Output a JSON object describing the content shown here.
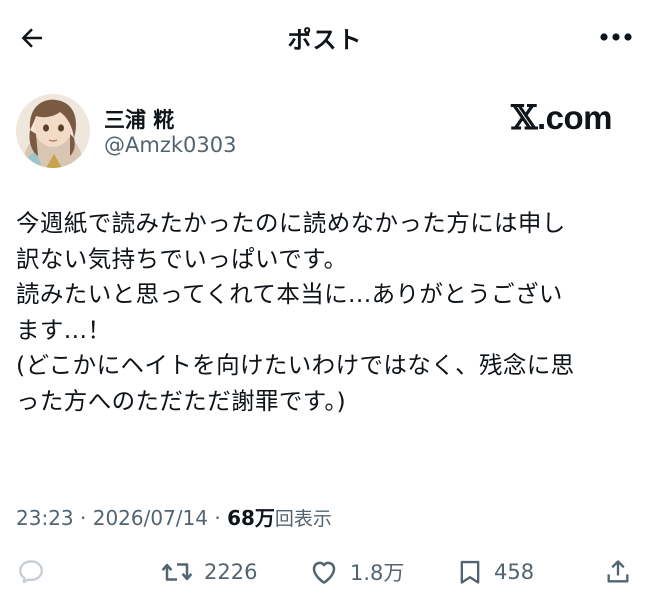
{
  "header": {
    "title": "ポスト"
  },
  "author": {
    "display_name": "三浦 糀",
    "handle": "@Amzk0303"
  },
  "source_logo": {
    "mark": "𝕏",
    "text": ".com"
  },
  "post": {
    "lines": [
      "今週紙で読みたかったのに読めなかった方には申し",
      "訳ない気持ちでいっぱいです。",
      "読みたいと思ってくれて本当に...ありがとうござい",
      "ます...！",
      "(どこかにヘイトを向けたいわけではなく、残念に思",
      "った方へのただただ謝罪です。)"
    ]
  },
  "meta": {
    "time": "23:23",
    "date": "2026/07/14",
    "sep": "·",
    "views": "68万",
    "views_label": "回表示"
  },
  "actions": {
    "reposts": "2226",
    "likes": "1.8万",
    "bookmarks": "458"
  },
  "icons": [
    "back-arrow-icon",
    "more-icon",
    "reply-icon",
    "repost-icon",
    "like-icon",
    "bookmark-icon",
    "share-icon"
  ],
  "colors": {
    "text": "#0f1419",
    "secondary": "#536471",
    "background": "#ffffff"
  }
}
